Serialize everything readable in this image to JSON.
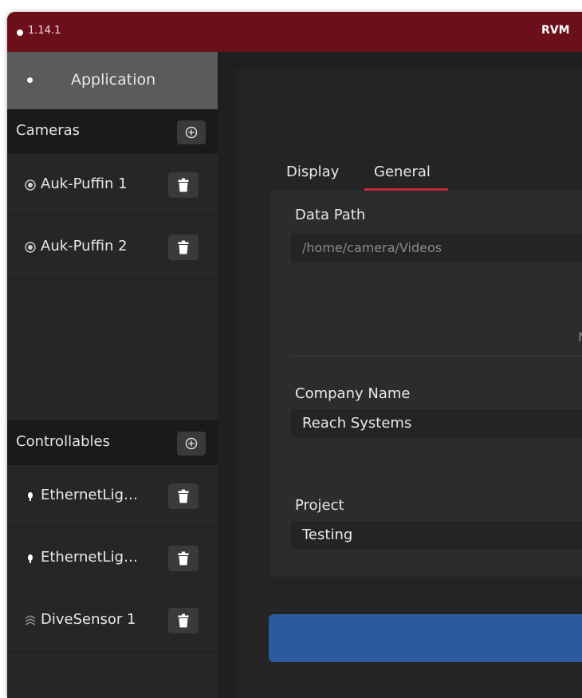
{
  "titlebar": {
    "version": "1.14.1",
    "title": "RVM"
  },
  "sidebar": {
    "application_label": "Application",
    "cameras": {
      "title": "Cameras",
      "items": [
        {
          "label": "Auk-Puffin 1",
          "icon": "camera-icon"
        },
        {
          "label": "Auk-Puffin 2",
          "icon": "camera-icon"
        }
      ]
    },
    "controllables": {
      "title": "Controllables",
      "items": [
        {
          "label": "EthernetLig…",
          "icon": "light-icon"
        },
        {
          "label": "EthernetLig…",
          "icon": "light-icon"
        },
        {
          "label": "DiveSensor 1",
          "icon": "sensor-icon"
        }
      ]
    }
  },
  "main": {
    "tabs": [
      {
        "label": "Display",
        "active": false
      },
      {
        "label": "General",
        "active": true
      }
    ],
    "data_path": {
      "label": "Data Path",
      "value": "/home/camera/Videos"
    },
    "truncated_text": "N",
    "company_name": {
      "label": "Company Name",
      "value": "Reach Systems"
    },
    "project": {
      "label": "Project",
      "value": "Testing"
    },
    "primary_button_label": ""
  },
  "colors": {
    "titlebar": "#6b0f1a",
    "accent_underline": "#c7283e",
    "primary_button": "#2c5aa0",
    "selected_sidebar": "#5b5b5b"
  }
}
